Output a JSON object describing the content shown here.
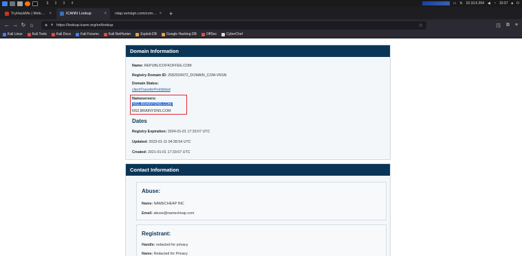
{
  "taskbar": {
    "workspaces": [
      "1",
      "2",
      "3",
      "4"
    ],
    "ip": "10.10.6.204",
    "time": "10:37"
  },
  "tabs": [
    {
      "label": "TryHackMe | WebOSINT",
      "color": "#c0392b"
    },
    {
      "label": "ICANN Lookup",
      "color": "#3b6fb6"
    },
    {
      "label": "rdap.verisign.com/com/v1/do",
      "color": "#888888"
    }
  ],
  "nav": {
    "url": "https://lookup.icann.org/en/lookup"
  },
  "bookmarks": [
    {
      "label": "Kali Linux",
      "color": "#3b82f6"
    },
    {
      "label": "Kali Tools",
      "color": "#e04848"
    },
    {
      "label": "Kali Docs",
      "color": "#e04848"
    },
    {
      "label": "Kali Forums",
      "color": "#3b82f6"
    },
    {
      "label": "Kali NetHunter",
      "color": "#e04848"
    },
    {
      "label": "Exploit-DB",
      "color": "#e8a33b"
    },
    {
      "label": "Google Hacking DB",
      "color": "#e8a33b"
    },
    {
      "label": "OffSec",
      "color": "#d9534f"
    },
    {
      "label": "CyberChef",
      "color": "#dddddd"
    }
  ],
  "domain_info": {
    "header": "Domain Information",
    "name_label": "Name:",
    "name_value": "REPUBLICOFKOFFEE.COM",
    "registry_id_label": "Registry Domain ID:",
    "registry_id_value": "2582024972_DOMAIN_COM-VRSN",
    "status_label": "Domain Status:",
    "status_value": "clientTransferProhibited",
    "nameservers_label": "Nameservers:",
    "nameservers": [
      "NS1.BRAINYDNS.COM",
      "NS2.BRAINYDNS.COM"
    ],
    "dates_header": "Dates",
    "expiration_label": "Registry Expiration:",
    "expiration_value": "2024-01-01 17:33:07 UTC",
    "updated_label": "Updated:",
    "updated_value": "2023-01-11 04:28:54 UTC",
    "created_label": "Created:",
    "created_value": "2021-01-01 17:33:07 UTC"
  },
  "contact_info": {
    "header": "Contact Information",
    "abuse_title": "Abuse:",
    "abuse_name_label": "Name:",
    "abuse_name_value": "NAMECHEAP INC",
    "abuse_email_label": "Email:",
    "abuse_email_value": "abuse@namecheap.com",
    "registrant_title": "Registrant:",
    "handle_label": "Handle:",
    "handle_value": "redacted for privacy",
    "registrant_name_label": "Name:",
    "registrant_name_value": "Redacted for Privacy"
  },
  "colors": {
    "header_bg": "#0b3556",
    "annotation_box": "#e0282e",
    "selection": "#2a6ad0"
  }
}
